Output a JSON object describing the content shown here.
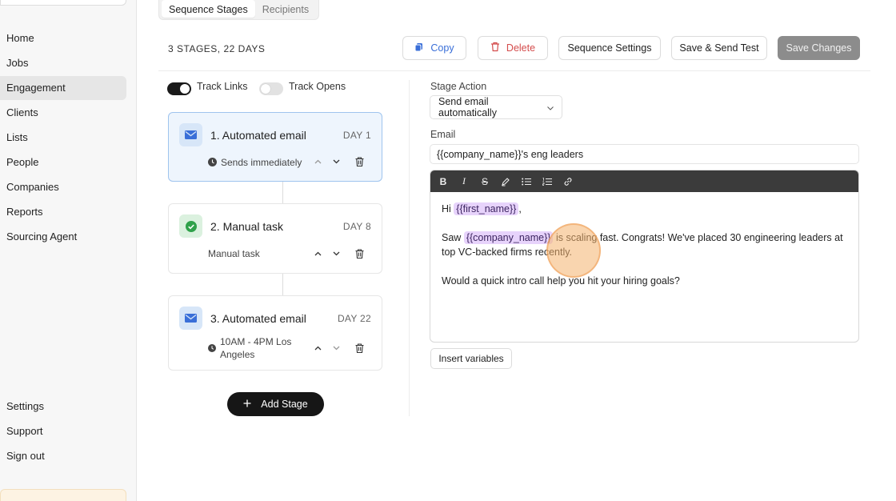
{
  "sidebar": {
    "items": [
      {
        "label": "Home"
      },
      {
        "label": "Jobs"
      },
      {
        "label": "Engagement"
      },
      {
        "label": "Clients"
      },
      {
        "label": "Lists"
      },
      {
        "label": "People"
      },
      {
        "label": "Companies"
      },
      {
        "label": "Reports"
      },
      {
        "label": "Sourcing Agent"
      }
    ],
    "active": "Engagement",
    "footer_items": [
      {
        "label": "Settings"
      },
      {
        "label": "Support"
      },
      {
        "label": "Sign out"
      }
    ]
  },
  "tabs": [
    {
      "label": "Sequence Stages",
      "active": true
    },
    {
      "label": "Recipients",
      "active": false
    }
  ],
  "summary": "3 STAGES, 22 DAYS",
  "actions": {
    "copy": "Copy",
    "delete": "Delete",
    "settings": "Sequence Settings",
    "send_test": "Save & Send Test",
    "save": "Save Changes"
  },
  "toggles": {
    "track_links": {
      "label": "Track Links",
      "on": true
    },
    "track_opens": {
      "label": "Track Opens",
      "on": false
    }
  },
  "stages": [
    {
      "title": "1. Automated email",
      "day": "DAY 1",
      "meta": "Sends immediately",
      "icon": "mail-icon"
    },
    {
      "title": "2. Manual task",
      "day": "DAY 8",
      "meta": "Manual task",
      "icon": "check-circle-icon"
    },
    {
      "title": "3. Automated email",
      "day": "DAY 22",
      "meta": "10AM - 4PM Los Angeles",
      "icon": "mail-icon"
    }
  ],
  "add_stage": "Add Stage",
  "editor_panel": {
    "stage_action_label": "Stage Action",
    "stage_action_value": "Send email automatically",
    "email_label": "Email",
    "subject": "{{company_name}}'s eng leaders",
    "body": {
      "greeting_prefix": "Hi",
      "greeting_var": "{{first_name}}",
      "greeting_suffix": ",",
      "p2_prefix": "Saw",
      "p2_var": "{{company_name}}",
      "p2_rest": "is scaling fast. Congrats! We've placed 30 engineering leaders at top VC-backed firms recently.",
      "p3": "Would a quick intro call help you hit your hiring goals?"
    },
    "insert_variables": "Insert variables"
  },
  "colors": {
    "accent_blue": "#3a6fd8",
    "danger": "#d44c4c",
    "variable_bg": "#e7d3fb",
    "selected_card_bg": "#eef5fd"
  }
}
